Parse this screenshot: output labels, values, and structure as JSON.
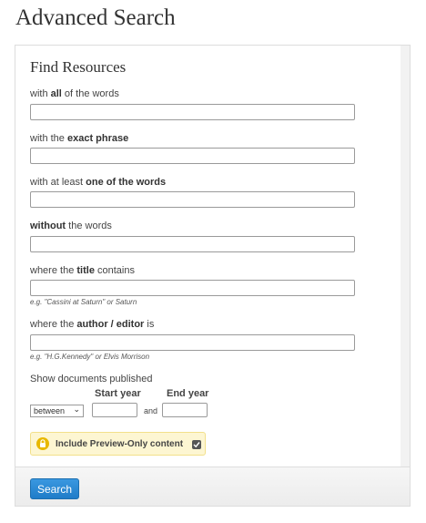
{
  "page": {
    "title": "Advanced Search"
  },
  "panel": {
    "section_title": "Find Resources"
  },
  "fields": {
    "all_words": {
      "prefix": "with ",
      "bold": "all",
      "suffix": " of the words",
      "value": ""
    },
    "exact_phrase": {
      "prefix": "with the ",
      "bold": "exact phrase",
      "suffix": "",
      "value": ""
    },
    "one_of_words": {
      "prefix": "with at least ",
      "bold": "one of the words",
      "suffix": "",
      "value": ""
    },
    "without_words": {
      "prefix": "",
      "bold": "without",
      "suffix": " the words",
      "value": ""
    },
    "title_contains": {
      "prefix": "where the ",
      "bold": "title",
      "suffix": " contains",
      "value": "",
      "hint": "e.g. \"Cassini at Saturn\" or Saturn"
    },
    "author_editor": {
      "prefix": "where the ",
      "bold": "author / editor",
      "suffix": " is",
      "value": "",
      "hint": "e.g. \"H.G.Kennedy\" or Elvis Morrison"
    }
  },
  "published": {
    "label": "Show documents published",
    "start_year_label": "Start year",
    "end_year_label": "End year",
    "range_selected": "between",
    "and_label": "and",
    "start_year_value": "",
    "end_year_value": ""
  },
  "preview": {
    "label": "Include Preview-Only content",
    "checked": true,
    "icon": "lock-icon",
    "accent": "#e8b800",
    "background": "#fdf6d2"
  },
  "actions": {
    "search_label": "Search",
    "accent": "#2a8ad6"
  }
}
